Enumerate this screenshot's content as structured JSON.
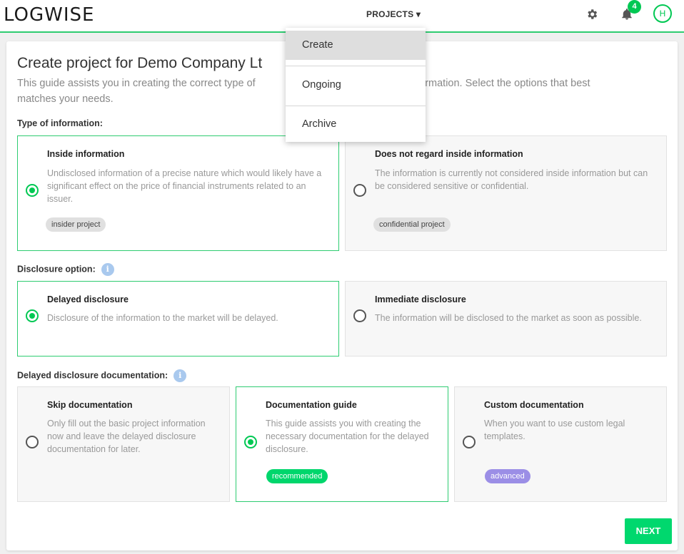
{
  "header": {
    "logo": "LOGWISE",
    "nav_projects": "PROJECTS ▾",
    "notification_count": "4",
    "avatar_initial": "H"
  },
  "dropdown": {
    "items": [
      "Create",
      "Ongoing",
      "Archive"
    ],
    "active": "Create"
  },
  "page": {
    "title": "Create project for Demo Company Lt",
    "intro_left": "This guide assists you in creating the correct type of",
    "intro_right": "ed information. Select the options that best",
    "intro_line2": "matches your needs."
  },
  "type_section": {
    "label": "Type of information:",
    "options": [
      {
        "title": "Inside information",
        "desc": "Undisclosed information of a precise nature which would likely have a significant effect on the price of financial instruments related to an issuer.",
        "tag": "insider project",
        "selected": true
      },
      {
        "title": "Does not regard inside information",
        "desc": "The information is currently not considered inside information but can be considered sensitive or confidential.",
        "tag": "confidential project",
        "selected": false
      }
    ]
  },
  "disclosure_section": {
    "label": "Disclosure option:",
    "info_icon": "i",
    "options": [
      {
        "title": "Delayed disclosure",
        "desc": "Disclosure of the information to the market will be delayed.",
        "selected": true
      },
      {
        "title": "Immediate disclosure",
        "desc": "The information will be disclosed to the market as soon as possible.",
        "selected": false
      }
    ]
  },
  "documentation_section": {
    "label": "Delayed disclosure documentation:",
    "info_icon": "i",
    "options": [
      {
        "title": "Skip documentation",
        "desc": "Only fill out the basic project information now and leave the delayed disclosure documentation for later.",
        "selected": false
      },
      {
        "title": "Documentation guide",
        "desc": "This guide assists you with creating the necessary documentation for the delayed disclosure.",
        "tag": "recommended",
        "selected": true
      },
      {
        "title": "Custom documentation",
        "desc": "When you want to use custom legal templates.",
        "tag": "advanced",
        "selected": false
      }
    ]
  },
  "actions": {
    "next_label": "NEXT"
  },
  "colors": {
    "accent": "#00c853",
    "selected_border": "#2ecc71",
    "tag_recommended": "#00d66c",
    "tag_advanced": "#9b8ee6"
  }
}
